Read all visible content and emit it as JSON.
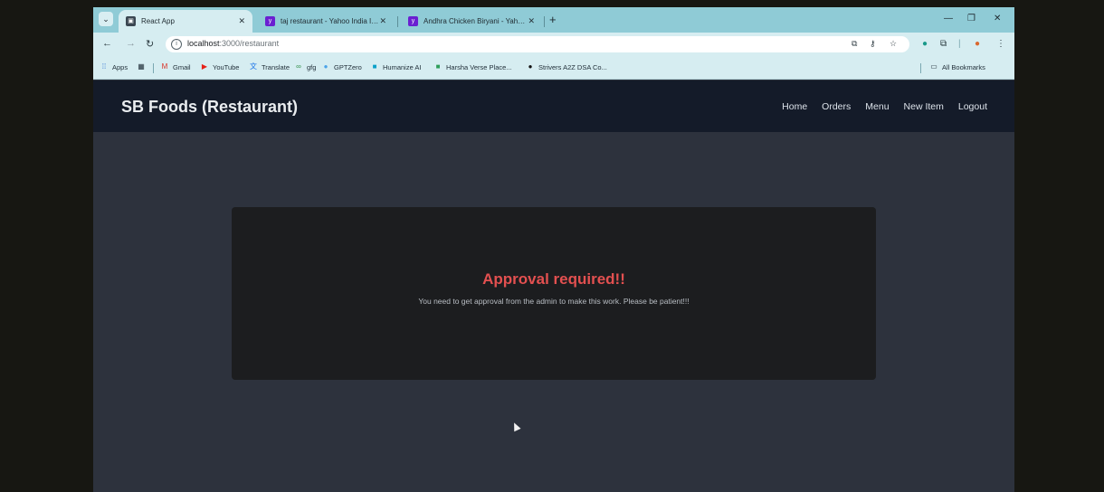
{
  "browser": {
    "tabs": [
      {
        "title": "React App",
        "favicon_color": "#3b4752",
        "active": true
      },
      {
        "title": "taj restaurant - Yahoo India In...",
        "favicon_color": "#6a1fd1",
        "active": false
      },
      {
        "title": "Andhra Chicken Biryani - Yahoo...",
        "favicon_color": "#6a1fd1",
        "active": false
      }
    ],
    "url_host": "localhost",
    "url_path": ":3000/restaurant",
    "bookmarks": [
      {
        "label": "Apps",
        "icon": "apps-grid-icon"
      },
      {
        "label": "Gmail",
        "icon": "gmail-icon"
      },
      {
        "label": "YouTube",
        "icon": "youtube-icon"
      },
      {
        "label": "Translate",
        "icon": "translate-icon"
      },
      {
        "label": "gfg",
        "icon": "gfg-icon"
      },
      {
        "label": "GPTZero",
        "icon": "gptzero-icon"
      },
      {
        "label": "Humanize AI",
        "icon": "humanize-icon"
      },
      {
        "label": "Harsha Verse Place...",
        "icon": "harsha-icon"
      },
      {
        "label": "Strivers A2Z DSA Co...",
        "icon": "strivers-icon"
      }
    ],
    "all_bookmarks": "All Bookmarks"
  },
  "app": {
    "brand": "SB Foods (Restaurant)",
    "nav": [
      "Home",
      "Orders",
      "Menu",
      "New Item",
      "Logout"
    ],
    "notice_title": "Approval required!!",
    "notice_text": "You need to get approval from the admin to make this work. Please be patient!!!"
  },
  "colors": {
    "navbar": "#141b29",
    "page_bg": "#2d323d",
    "card_bg": "#1c1d1f",
    "notice_title": "#e35050"
  }
}
